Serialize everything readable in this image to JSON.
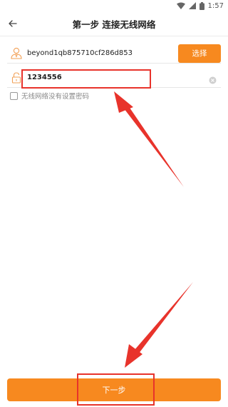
{
  "status_bar": {
    "time": "1:57"
  },
  "header": {
    "title": "第一步 连接无线网络"
  },
  "wifi_form": {
    "ssid": "beyond1qb875710cf286d853",
    "select_label": "选择",
    "password": "1234556",
    "no_password_label": "无线网络没有设置密码"
  },
  "footer": {
    "next_label": "下一步"
  },
  "colors": {
    "accent": "#f7891f",
    "annotation": "#e8332b"
  }
}
